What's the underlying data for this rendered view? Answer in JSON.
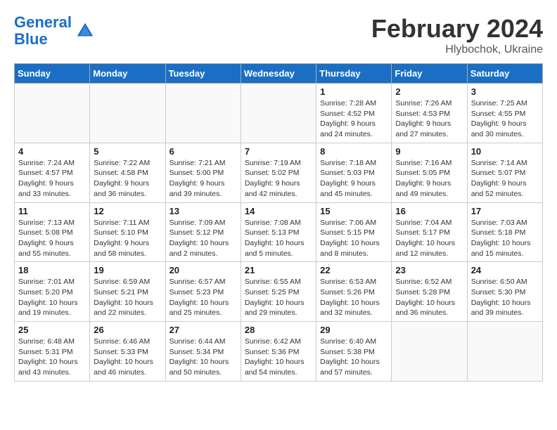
{
  "header": {
    "logo_line1": "General",
    "logo_line2": "Blue",
    "month_year": "February 2024",
    "location": "Hlybochok, Ukraine"
  },
  "weekdays": [
    "Sunday",
    "Monday",
    "Tuesday",
    "Wednesday",
    "Thursday",
    "Friday",
    "Saturday"
  ],
  "weeks": [
    [
      {
        "day": "",
        "info": ""
      },
      {
        "day": "",
        "info": ""
      },
      {
        "day": "",
        "info": ""
      },
      {
        "day": "",
        "info": ""
      },
      {
        "day": "1",
        "info": "Sunrise: 7:28 AM\nSunset: 4:52 PM\nDaylight: 9 hours\nand 24 minutes."
      },
      {
        "day": "2",
        "info": "Sunrise: 7:26 AM\nSunset: 4:53 PM\nDaylight: 9 hours\nand 27 minutes."
      },
      {
        "day": "3",
        "info": "Sunrise: 7:25 AM\nSunset: 4:55 PM\nDaylight: 9 hours\nand 30 minutes."
      }
    ],
    [
      {
        "day": "4",
        "info": "Sunrise: 7:24 AM\nSunset: 4:57 PM\nDaylight: 9 hours\nand 33 minutes."
      },
      {
        "day": "5",
        "info": "Sunrise: 7:22 AM\nSunset: 4:58 PM\nDaylight: 9 hours\nand 36 minutes."
      },
      {
        "day": "6",
        "info": "Sunrise: 7:21 AM\nSunset: 5:00 PM\nDaylight: 9 hours\nand 39 minutes."
      },
      {
        "day": "7",
        "info": "Sunrise: 7:19 AM\nSunset: 5:02 PM\nDaylight: 9 hours\nand 42 minutes."
      },
      {
        "day": "8",
        "info": "Sunrise: 7:18 AM\nSunset: 5:03 PM\nDaylight: 9 hours\nand 45 minutes."
      },
      {
        "day": "9",
        "info": "Sunrise: 7:16 AM\nSunset: 5:05 PM\nDaylight: 9 hours\nand 49 minutes."
      },
      {
        "day": "10",
        "info": "Sunrise: 7:14 AM\nSunset: 5:07 PM\nDaylight: 9 hours\nand 52 minutes."
      }
    ],
    [
      {
        "day": "11",
        "info": "Sunrise: 7:13 AM\nSunset: 5:08 PM\nDaylight: 9 hours\nand 55 minutes."
      },
      {
        "day": "12",
        "info": "Sunrise: 7:11 AM\nSunset: 5:10 PM\nDaylight: 9 hours\nand 58 minutes."
      },
      {
        "day": "13",
        "info": "Sunrise: 7:09 AM\nSunset: 5:12 PM\nDaylight: 10 hours\nand 2 minutes."
      },
      {
        "day": "14",
        "info": "Sunrise: 7:08 AM\nSunset: 5:13 PM\nDaylight: 10 hours\nand 5 minutes."
      },
      {
        "day": "15",
        "info": "Sunrise: 7:06 AM\nSunset: 5:15 PM\nDaylight: 10 hours\nand 8 minutes."
      },
      {
        "day": "16",
        "info": "Sunrise: 7:04 AM\nSunset: 5:17 PM\nDaylight: 10 hours\nand 12 minutes."
      },
      {
        "day": "17",
        "info": "Sunrise: 7:03 AM\nSunset: 5:18 PM\nDaylight: 10 hours\nand 15 minutes."
      }
    ],
    [
      {
        "day": "18",
        "info": "Sunrise: 7:01 AM\nSunset: 5:20 PM\nDaylight: 10 hours\nand 19 minutes."
      },
      {
        "day": "19",
        "info": "Sunrise: 6:59 AM\nSunset: 5:21 PM\nDaylight: 10 hours\nand 22 minutes."
      },
      {
        "day": "20",
        "info": "Sunrise: 6:57 AM\nSunset: 5:23 PM\nDaylight: 10 hours\nand 25 minutes."
      },
      {
        "day": "21",
        "info": "Sunrise: 6:55 AM\nSunset: 5:25 PM\nDaylight: 10 hours\nand 29 minutes."
      },
      {
        "day": "22",
        "info": "Sunrise: 6:53 AM\nSunset: 5:26 PM\nDaylight: 10 hours\nand 32 minutes."
      },
      {
        "day": "23",
        "info": "Sunrise: 6:52 AM\nSunset: 5:28 PM\nDaylight: 10 hours\nand 36 minutes."
      },
      {
        "day": "24",
        "info": "Sunrise: 6:50 AM\nSunset: 5:30 PM\nDaylight: 10 hours\nand 39 minutes."
      }
    ],
    [
      {
        "day": "25",
        "info": "Sunrise: 6:48 AM\nSunset: 5:31 PM\nDaylight: 10 hours\nand 43 minutes."
      },
      {
        "day": "26",
        "info": "Sunrise: 6:46 AM\nSunset: 5:33 PM\nDaylight: 10 hours\nand 46 minutes."
      },
      {
        "day": "27",
        "info": "Sunrise: 6:44 AM\nSunset: 5:34 PM\nDaylight: 10 hours\nand 50 minutes."
      },
      {
        "day": "28",
        "info": "Sunrise: 6:42 AM\nSunset: 5:36 PM\nDaylight: 10 hours\nand 54 minutes."
      },
      {
        "day": "29",
        "info": "Sunrise: 6:40 AM\nSunset: 5:38 PM\nDaylight: 10 hours\nand 57 minutes."
      },
      {
        "day": "",
        "info": ""
      },
      {
        "day": "",
        "info": ""
      }
    ]
  ]
}
